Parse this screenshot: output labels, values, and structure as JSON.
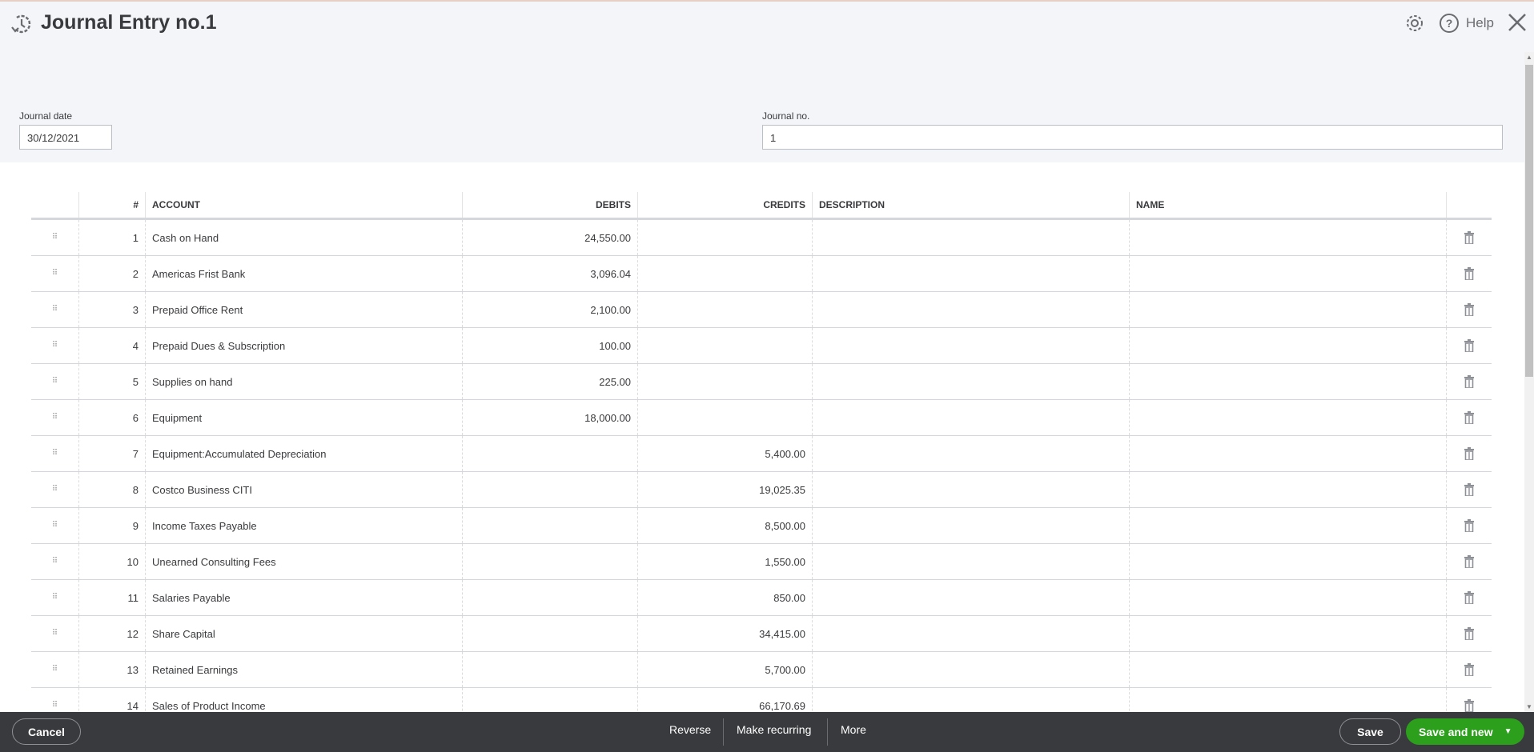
{
  "header": {
    "title": "Journal Entry no.1",
    "help_label": "Help"
  },
  "form": {
    "journal_date_label": "Journal date",
    "journal_date_value": "30/12/2021",
    "journal_no_label": "Journal no.",
    "journal_no_value": "1"
  },
  "table": {
    "columns": [
      "#",
      "ACCOUNT",
      "DEBITS",
      "CREDITS",
      "DESCRIPTION",
      "NAME"
    ],
    "rows": [
      {
        "num": "1",
        "account": "Cash on Hand",
        "debit": "24,550.00",
        "credit": ""
      },
      {
        "num": "2",
        "account": "Americas Frist Bank",
        "debit": "3,096.04",
        "credit": ""
      },
      {
        "num": "3",
        "account": "Prepaid Office Rent",
        "debit": "2,100.00",
        "credit": ""
      },
      {
        "num": "4",
        "account": "Prepaid Dues & Subscription",
        "debit": "100.00",
        "credit": ""
      },
      {
        "num": "5",
        "account": "Supplies on hand",
        "debit": "225.00",
        "credit": ""
      },
      {
        "num": "6",
        "account": "Equipment",
        "debit": "18,000.00",
        "credit": ""
      },
      {
        "num": "7",
        "account": "Equipment:Accumulated Depreciation",
        "debit": "",
        "credit": "5,400.00"
      },
      {
        "num": "8",
        "account": "Costco Business CITI",
        "debit": "",
        "credit": "19,025.35"
      },
      {
        "num": "9",
        "account": "Income Taxes Payable",
        "debit": "",
        "credit": "8,500.00"
      },
      {
        "num": "10",
        "account": "Unearned Consulting Fees",
        "debit": "",
        "credit": "1,550.00"
      },
      {
        "num": "11",
        "account": "Salaries Payable",
        "debit": "",
        "credit": "850.00"
      },
      {
        "num": "12",
        "account": "Share Capital",
        "debit": "",
        "credit": "34,415.00"
      },
      {
        "num": "13",
        "account": "Retained Earnings",
        "debit": "",
        "credit": "5,700.00"
      },
      {
        "num": "14",
        "account": "Sales of Product Income",
        "debit": "",
        "credit": "66,170.69"
      }
    ]
  },
  "footer": {
    "cancel": "Cancel",
    "reverse": "Reverse",
    "make_recurring": "Make recurring",
    "more": "More",
    "save": "Save",
    "save_and_new": "Save and new"
  },
  "colors": {
    "primary_green": "#2ca01c",
    "footer_bg": "#393a3d",
    "header_bg": "#f4f5f8"
  }
}
